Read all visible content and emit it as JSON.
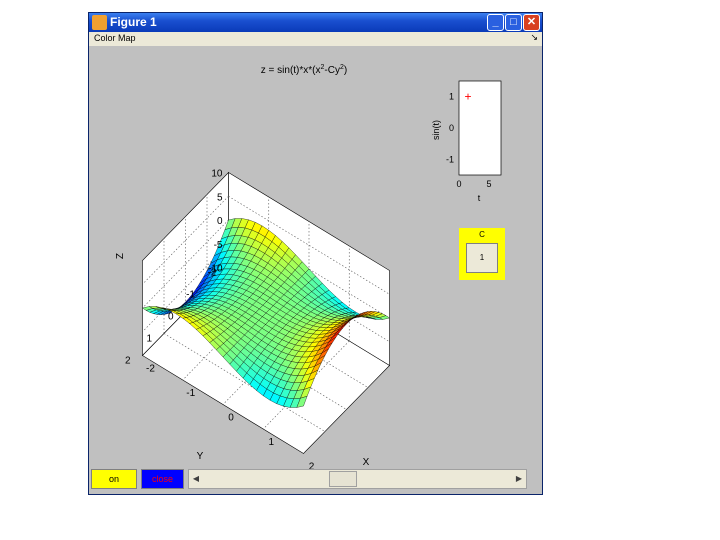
{
  "window": {
    "title": "Figure 1",
    "minimize": "_",
    "maximize": "□",
    "close": "✕"
  },
  "menu": {
    "items": [
      "Color Map"
    ],
    "dock_glyph": "↘"
  },
  "plot3d": {
    "title_prefix": "z = sin(t)*x*(x",
    "title_sup1": "2",
    "title_mid": "-Cy",
    "title_sup2": "2",
    "title_suffix": ")",
    "xlabel": "X",
    "ylabel": "Y",
    "zlabel": "Z",
    "x_ticks": [
      "-2",
      "-1",
      "0",
      "1",
      "2"
    ],
    "y_ticks": [
      "-2",
      "-1",
      "0",
      "1",
      "2"
    ],
    "z_ticks": [
      "-10",
      "-5",
      "0",
      "5",
      "10"
    ]
  },
  "inset": {
    "xlabel": "t",
    "ylabel": "sin(t)",
    "x_ticks": [
      "0",
      "5"
    ],
    "y_ticks": [
      "1",
      "0",
      "-1"
    ],
    "marker": "+",
    "marker_color": "#ff0000"
  },
  "c_control": {
    "label": "C",
    "value": "1",
    "bg_color": "#ffff00"
  },
  "buttons": {
    "on": "on",
    "close": "close"
  },
  "slider": {
    "left_arrow": "◀",
    "right_arrow": "▶"
  },
  "chart_data": [
    {
      "type": "surface",
      "title": "z = sin(t)*x*(x^2-Cy^2)",
      "xlabel": "X",
      "ylabel": "Y",
      "zlabel": "Z",
      "xlim": [
        -2,
        2
      ],
      "ylim": [
        -2,
        2
      ],
      "zlim": [
        -10,
        10
      ],
      "params": {
        "C": 1,
        "sin_t": 1
      },
      "grid": true,
      "colormap": "jet"
    },
    {
      "type": "scatter",
      "xlabel": "t",
      "ylabel": "sin(t)",
      "xlim": [
        0,
        7
      ],
      "ylim": [
        -1.5,
        1.5
      ],
      "points": [
        {
          "x": 1.5,
          "y": 1.0
        }
      ],
      "marker": "+",
      "color": "#ff0000"
    }
  ]
}
